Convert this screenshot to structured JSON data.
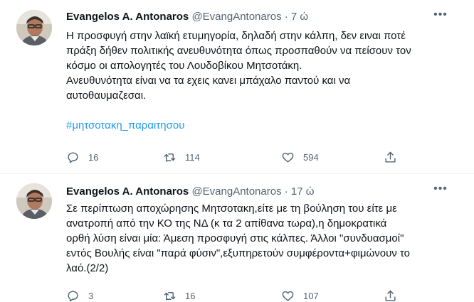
{
  "tweets": [
    {
      "name": "Evangelos A. Antonaros",
      "handle": "@EvangAntonaros",
      "separator": "·",
      "time": "7 ώ",
      "more_label": "•••",
      "lines": [
        "Η προσφυγή στην λαϊκή ετυμηγορία, δηλαδή στην κάλπη, δεν ειναι ποτέ",
        "πράξη δήθεν πολιτικής ανευθυνότητα όπως προσπαθούν να πείσουν τον",
        "κόσμο οι απολογητές του Λουδοβίκου Μητσοτάκη.",
        "Ανευθυνότητα είναι να τα εχεις κανει μπάχαλο παντού και να",
        "αυτοθαυμαζεσαι."
      ],
      "hashtag": "#μητσοτακη_παραιτησου",
      "reply_count": "16",
      "retweet_count": "114",
      "like_count": "594"
    },
    {
      "name": "Evangelos A. Antonaros",
      "handle": "@EvangAntonaros",
      "separator": "·",
      "time": "17 ώ",
      "more_label": "•••",
      "lines": [
        "Σε περίπτωση αποχώρησης Μητσοτακη,είτε με τη βούληση του είτε με",
        "ανατροπή από την ΚΟ της ΝΔ (κ τα 2 απίθανα τωρα),η δημοκρατικά",
        "ορθή λύση είναι μία: Άμεση προσφυγή στις κάλπες. Άλλοι  \"συνδυασμοί\"",
        "εντός Βουλής είναι \"παρά φύσιν\",εξυπηρετούν συμφέροντα+φιμώνουν το",
        "λαό.(2/2)"
      ],
      "reply_count": "3",
      "retweet_count": "16",
      "like_count": "107"
    }
  ],
  "icons": {
    "reply": "reply-icon",
    "retweet": "retweet-icon",
    "like": "like-icon",
    "share": "share-icon",
    "more": "more-icon"
  },
  "colors": {
    "text": "#0f1419",
    "secondary": "#536471",
    "link": "#1d9bf0",
    "divider": "#eff3f4"
  }
}
